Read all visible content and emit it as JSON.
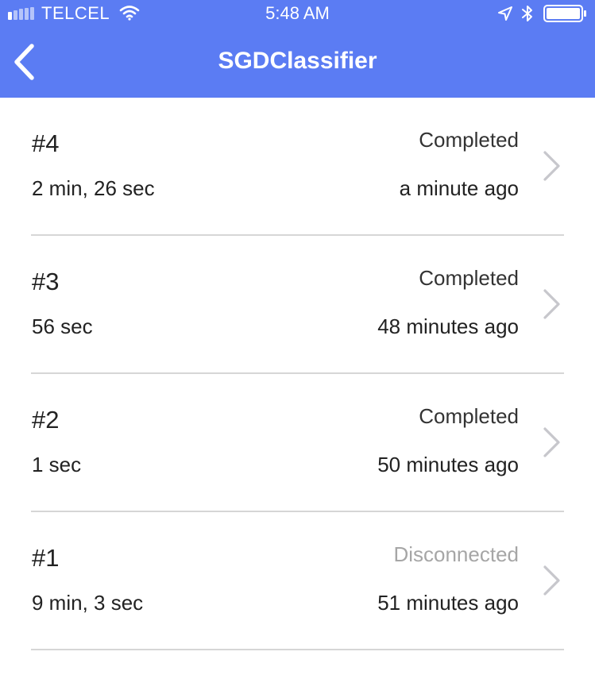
{
  "status_bar": {
    "carrier": "TELCEL",
    "time": "5:48 AM",
    "icons": [
      "signal-icon",
      "wifi-icon",
      "location-arrow-icon",
      "bluetooth-icon",
      "battery-icon"
    ]
  },
  "nav": {
    "title": "SGDClassifier",
    "back_icon": "chevron-left-icon"
  },
  "colors": {
    "header": "#5b7cf3",
    "text": "#222222",
    "muted": "#a6a6a6",
    "divider": "#d6d6d6"
  },
  "runs": [
    {
      "id": "#4",
      "duration": "2 min, 26 sec",
      "status": "Completed",
      "ago": "a minute ago"
    },
    {
      "id": "#3",
      "duration": "56 sec",
      "status": "Completed",
      "ago": "48 minutes ago"
    },
    {
      "id": "#2",
      "duration": "1 sec",
      "status": "Completed",
      "ago": "50 minutes ago"
    },
    {
      "id": "#1",
      "duration": "9 min, 3 sec",
      "status": "Disconnected",
      "ago": "51 minutes ago"
    }
  ]
}
